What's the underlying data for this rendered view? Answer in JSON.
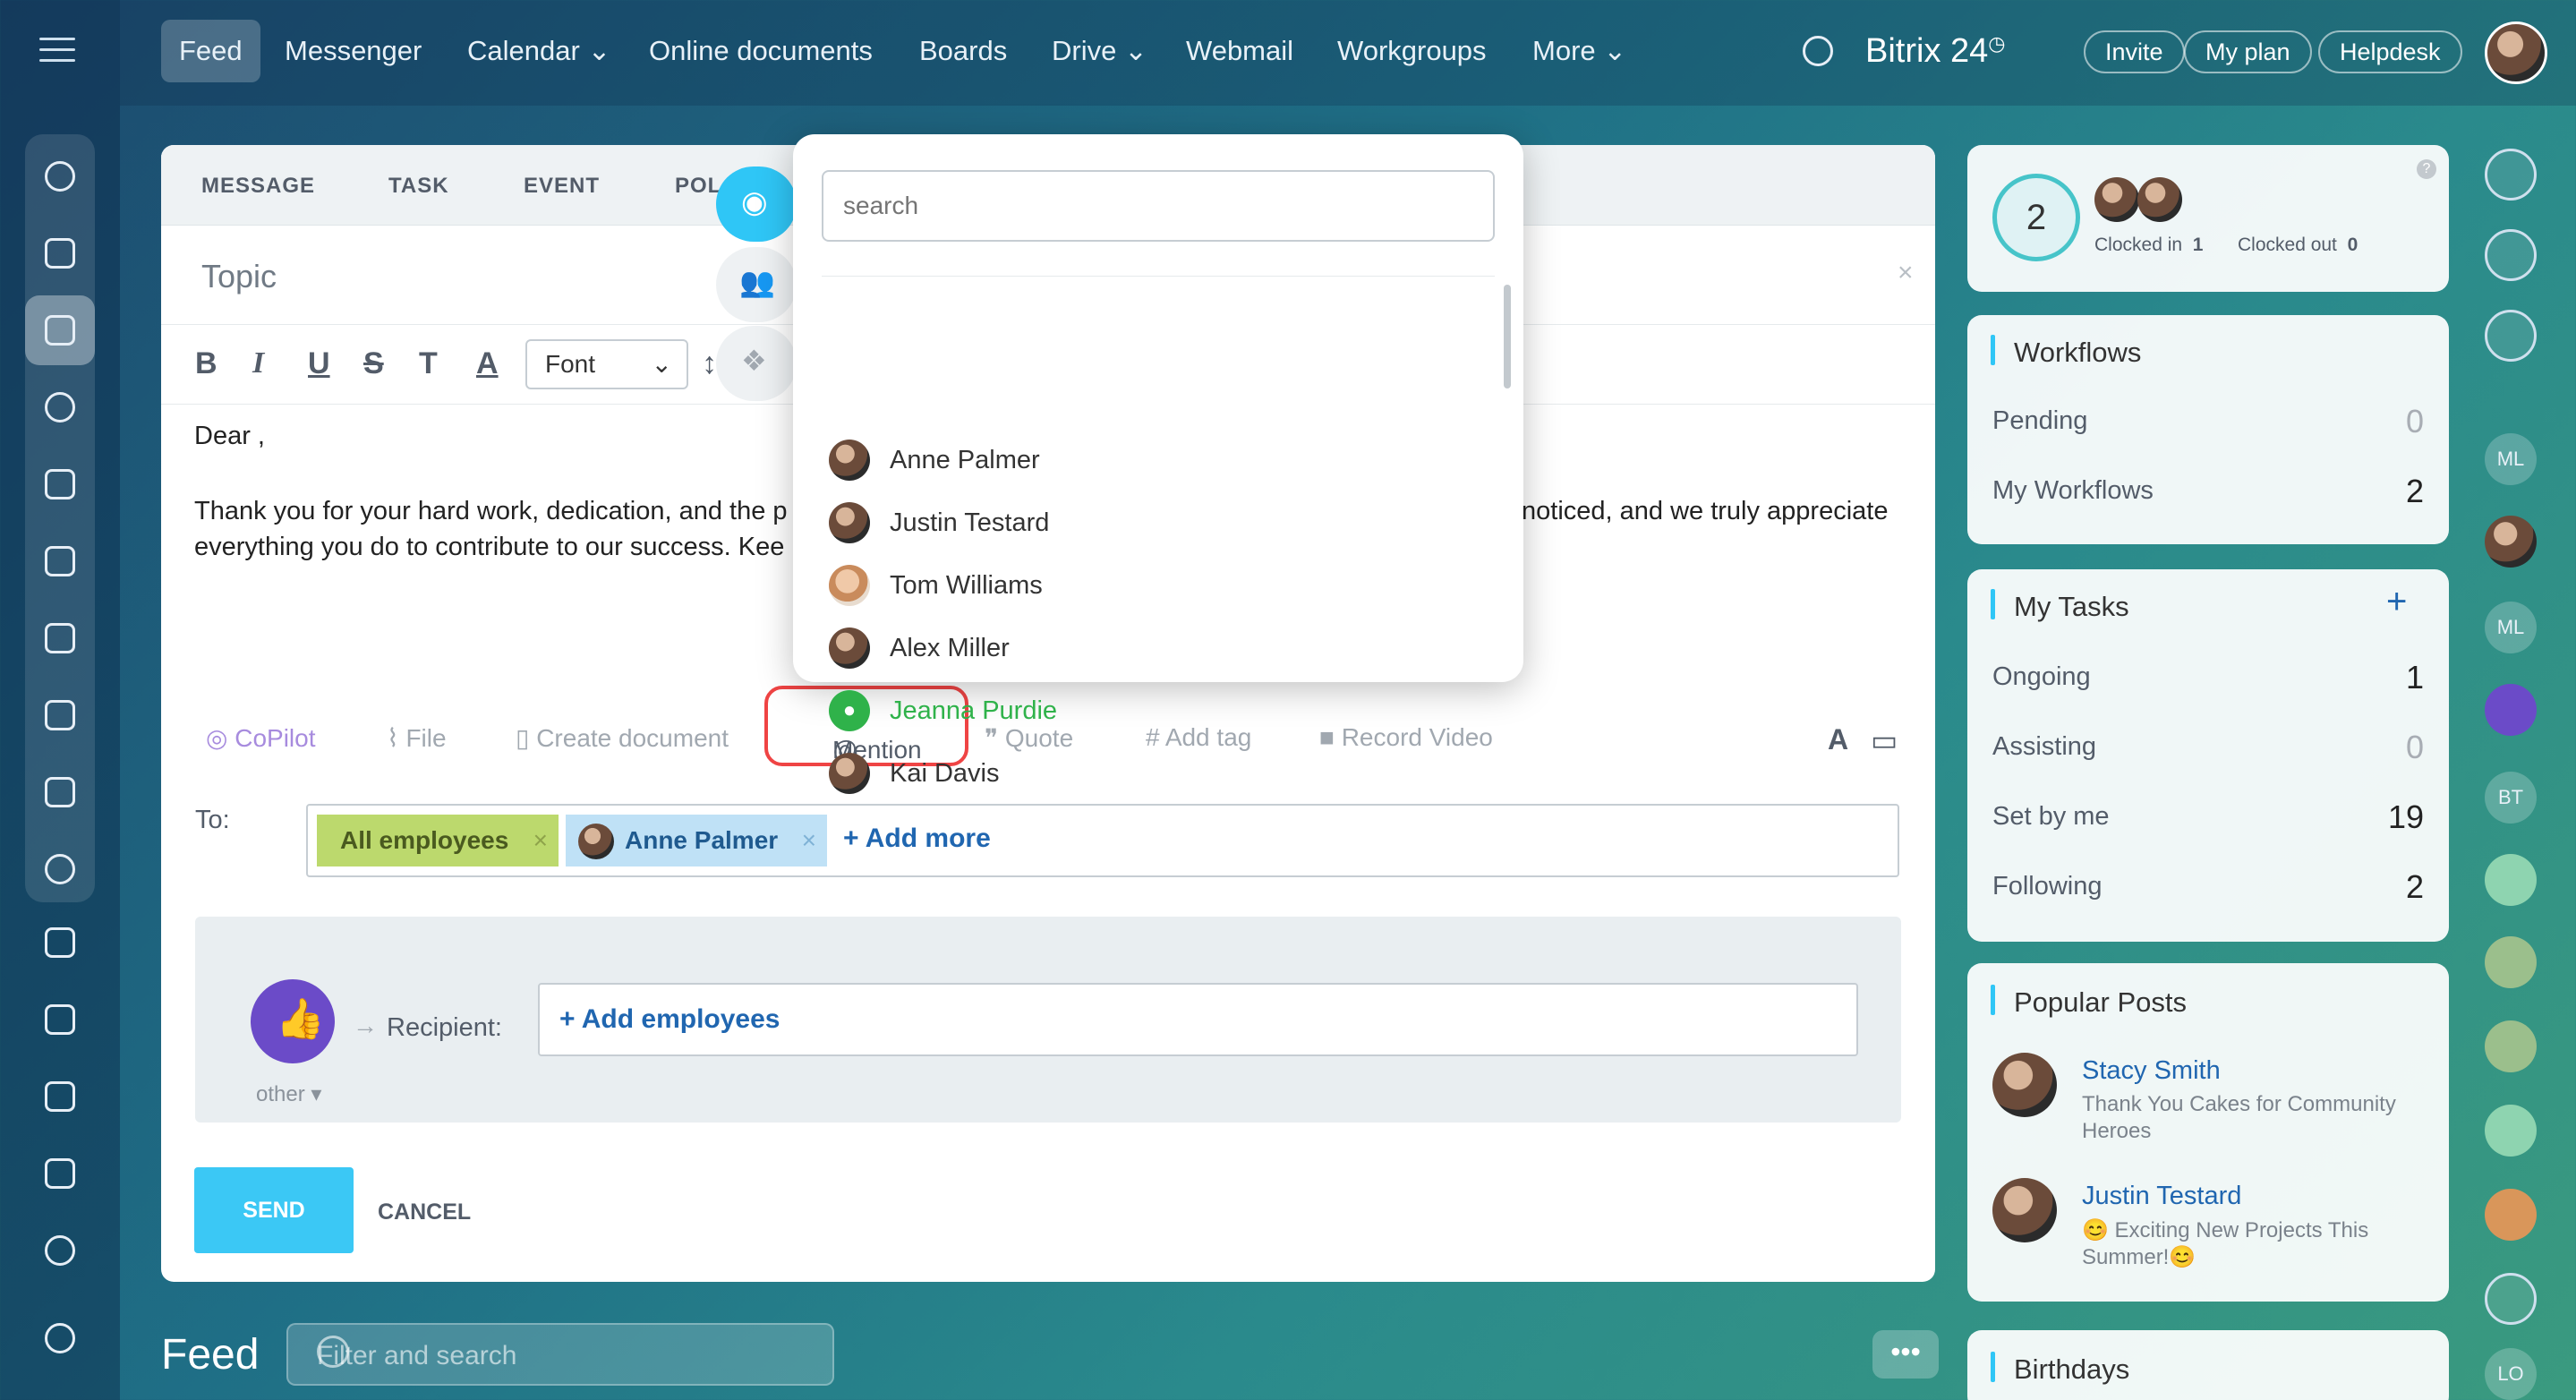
{
  "topnav": {
    "items": [
      "Feed",
      "Messenger",
      "Calendar",
      "Online documents",
      "Boards",
      "Drive",
      "Webmail",
      "Workgroups",
      "More"
    ],
    "brand": "Bitrix 24",
    "invite": "Invite",
    "myplan": "My plan",
    "helpdesk": "Helpdesk"
  },
  "composer": {
    "tabs": [
      "MESSAGE",
      "TASK",
      "EVENT",
      "POL"
    ],
    "topic_placeholder": "Topic",
    "font_label": "Font",
    "body": {
      "line1": "Dear ,",
      "line2": "Thank you for your hard work, dedication, and the p",
      "line2_tail": "noticed, and we truly appreciate",
      "line3": "everything you do to contribute to our success. Kee"
    },
    "actions": {
      "copilot": "CoPilot",
      "file": "File",
      "create_document": "Create document",
      "mention": "Mention",
      "quote": "Quote",
      "add_tag": "Add tag",
      "record_video": "Record Video"
    },
    "to_label": "To:",
    "chips": [
      "All employees",
      "Anne Palmer"
    ],
    "add_more": "+ Add more",
    "recipient_label": "Recipient:",
    "add_employees": "+ Add employees",
    "other_label": "other",
    "send": "SEND",
    "cancel": "CANCEL"
  },
  "mention_popup": {
    "search_placeholder": "search",
    "people": [
      "Anne Palmer",
      "Justin Testard",
      "Tom Williams",
      "Alex Miller",
      "Jeanna Purdie",
      "Kai Davis"
    ]
  },
  "timeman": {
    "count": "2",
    "clocked_in_label": "Clocked in",
    "clocked_in_value": "1",
    "clocked_out_label": "Clocked out",
    "clocked_out_value": "0"
  },
  "workflows": {
    "title": "Workflows",
    "rows": [
      {
        "label": "Pending",
        "value": "0"
      },
      {
        "label": "My Workflows",
        "value": "2"
      }
    ]
  },
  "tasks": {
    "title": "My Tasks",
    "add": "+",
    "rows": [
      {
        "label": "Ongoing",
        "value": "1"
      },
      {
        "label": "Assisting",
        "value": "0"
      },
      {
        "label": "Set by me",
        "value": "19"
      },
      {
        "label": "Following",
        "value": "2"
      }
    ]
  },
  "popular": {
    "title": "Popular Posts",
    "posts": [
      {
        "author": "Stacy Smith",
        "text1": "Thank You Cakes for Community",
        "text2": "Heroes"
      },
      {
        "author": "Justin Testard",
        "text1": "😊 Exciting New Projects This",
        "text2": "Summer!😊"
      }
    ]
  },
  "birthdays": {
    "title": "Birthdays"
  },
  "right_initials": [
    "ML",
    "ML",
    "BT",
    "LO"
  ],
  "feed": {
    "title": "Feed",
    "filter_placeholder": "Filter and search",
    "more": "•••"
  },
  "colors": {
    "accent": "#2fc6f6",
    "link": "#2066b0",
    "highlight": "#ef4444",
    "online": "#2fb24a"
  }
}
